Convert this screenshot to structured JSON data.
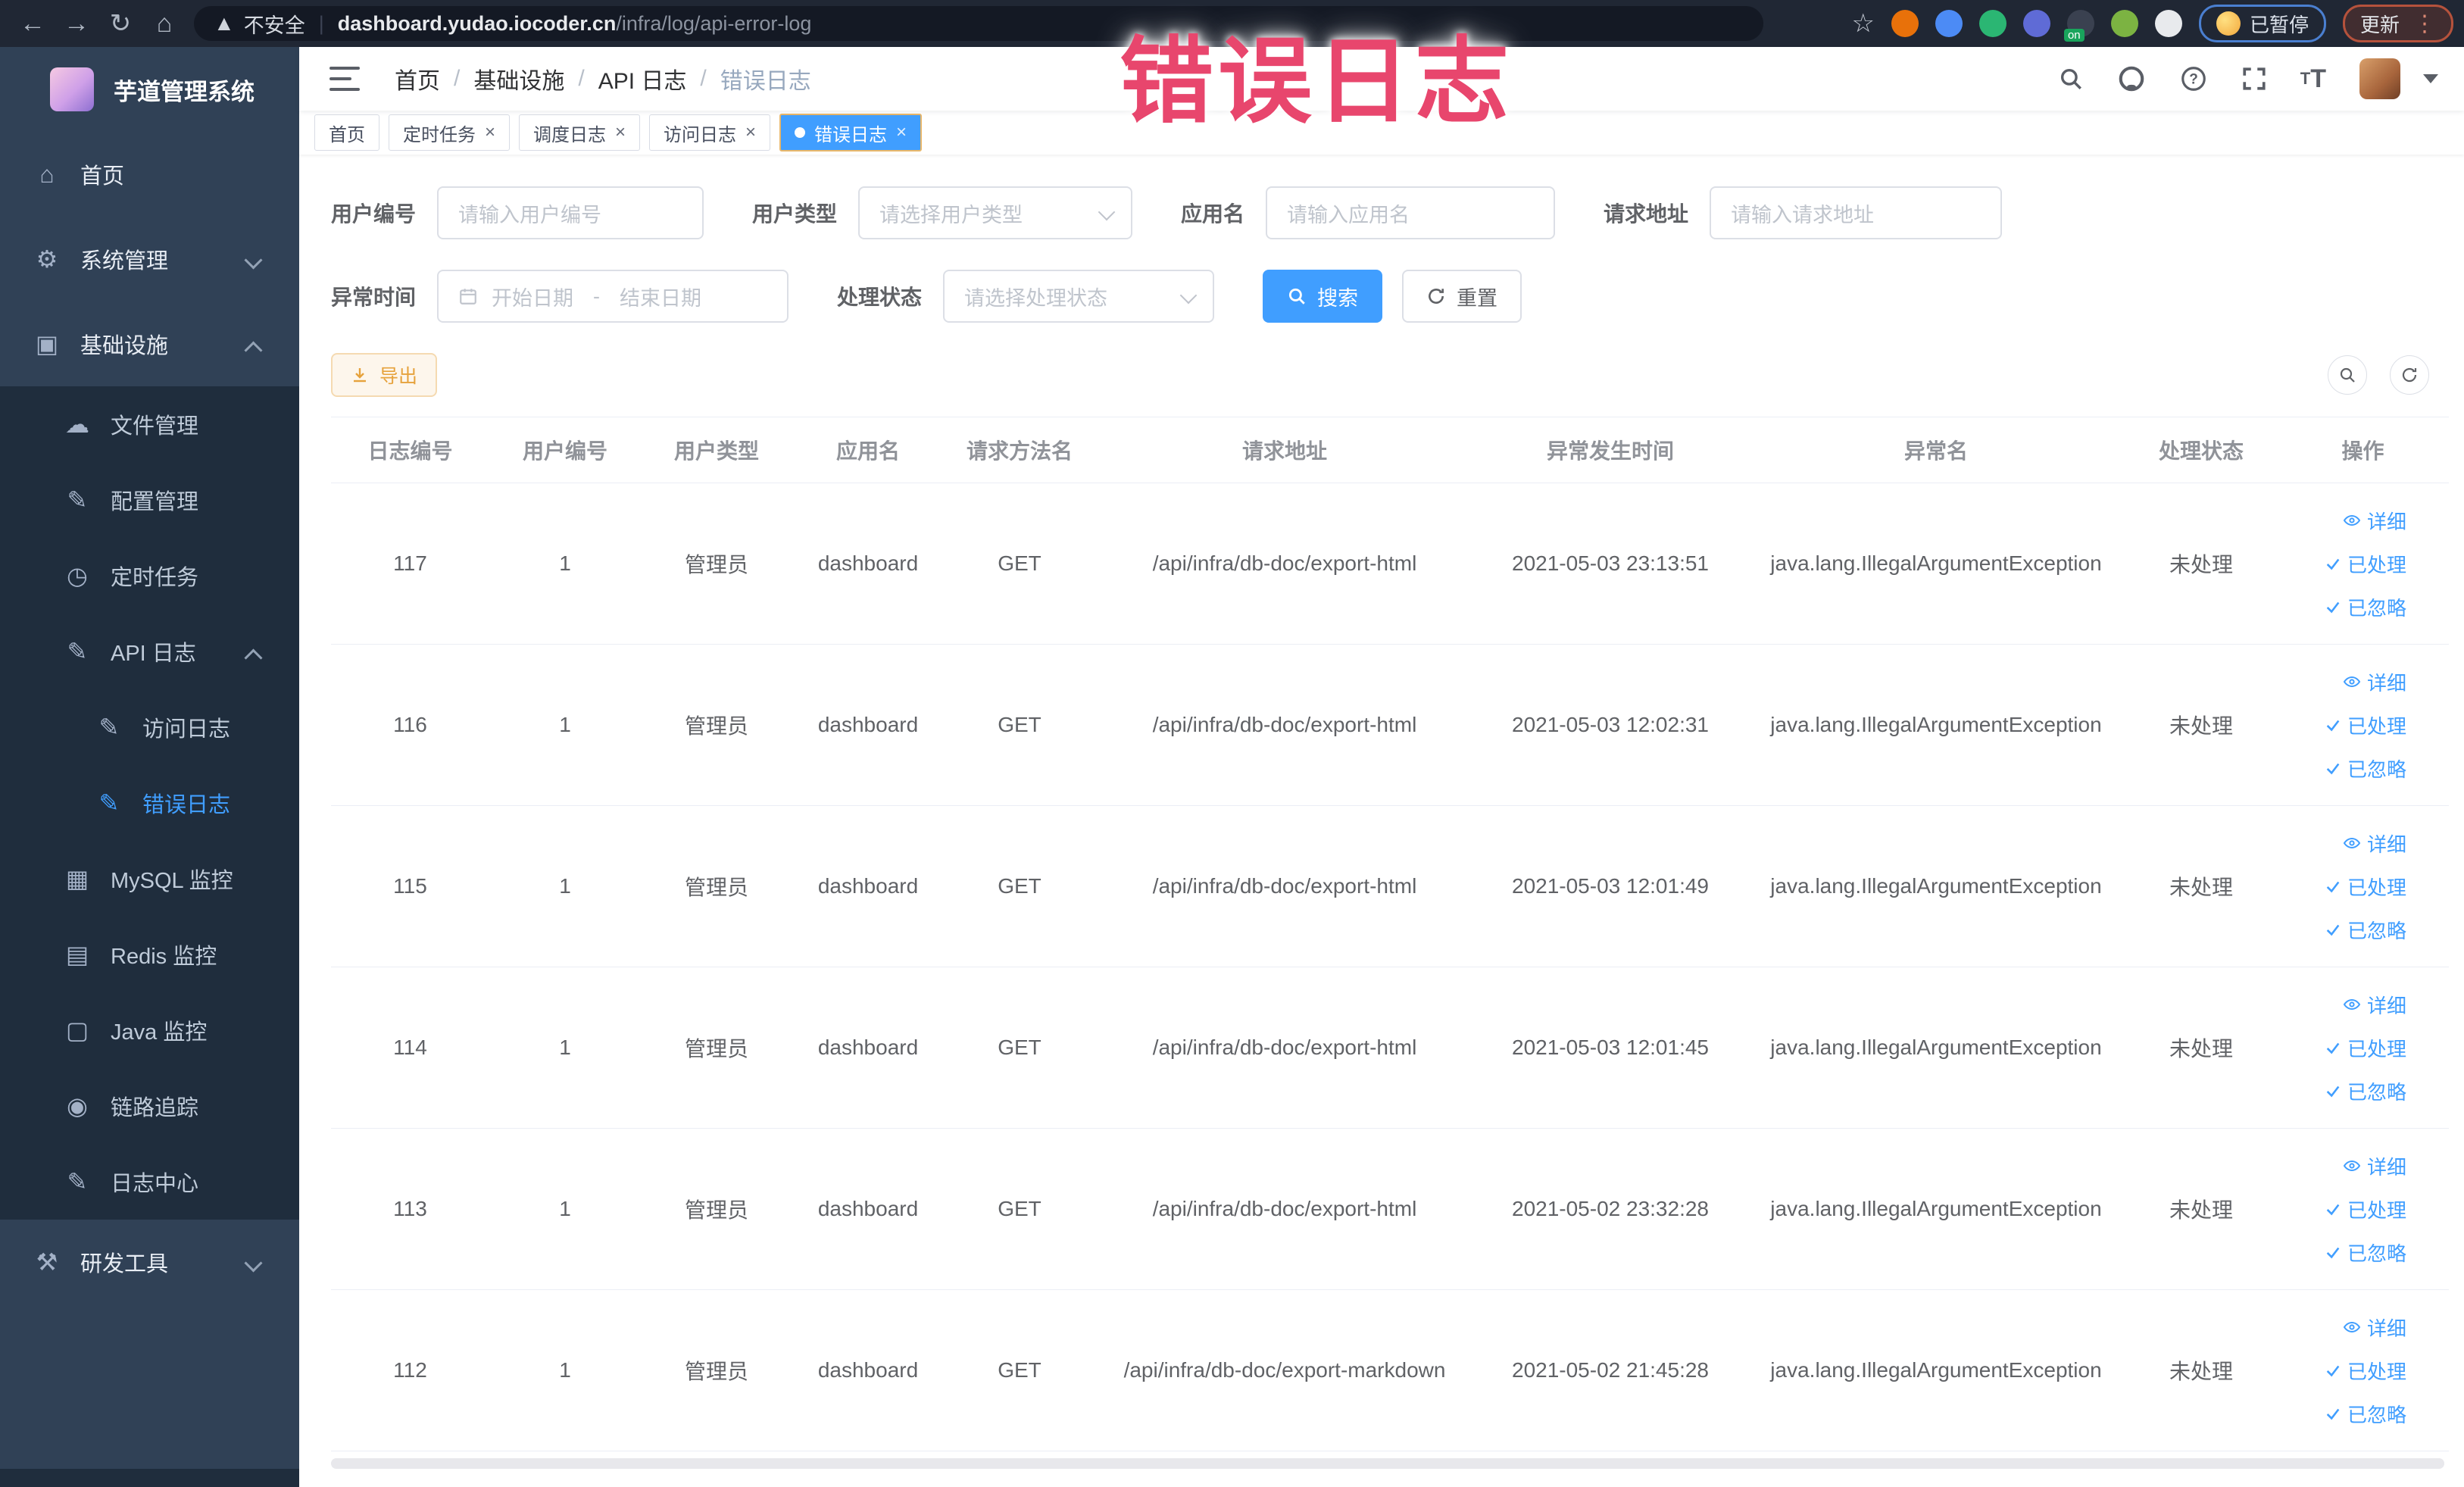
{
  "browser": {
    "security_label": "不安全",
    "url_domain": "dashboard.yudao.iocoder.cn",
    "url_path": "/infra/log/api-error-log",
    "profile_chip_label": "已暂停",
    "update_chip_label": "更新",
    "extensions": [
      {
        "icon": "extension-orange-icon",
        "color": "#e8710a"
      },
      {
        "icon": "extension-location-icon",
        "color": "#4c8bf5"
      },
      {
        "icon": "extension-green-v-icon",
        "color": "#2bb673"
      },
      {
        "icon": "extension-grid-icon",
        "color": "#5f6bd6"
      },
      {
        "icon": "extension-on-icon",
        "color": "#3a4150",
        "badge": "on"
      },
      {
        "icon": "extension-leaf-icon",
        "color": "#7cb342"
      },
      {
        "icon": "extension-puzzle-icon",
        "color": "#e8eaed"
      }
    ]
  },
  "sidebar": {
    "title": "芋道管理系统",
    "items": [
      {
        "key": "home",
        "label": "首页",
        "icon": "dashboard-icon",
        "level": 0
      },
      {
        "key": "system-management",
        "label": "系统管理",
        "icon": "gear-icon",
        "level": 0,
        "chevron": "down"
      },
      {
        "key": "infrastructure",
        "label": "基础设施",
        "icon": "monitor-icon",
        "level": 0,
        "chevron": "up"
      },
      {
        "key": "file-management",
        "label": "文件管理",
        "icon": "cloud-upload-icon",
        "level": 1
      },
      {
        "key": "config-management",
        "label": "配置管理",
        "icon": "edit-icon",
        "level": 1
      },
      {
        "key": "scheduled-jobs",
        "label": "定时任务",
        "icon": "timer-icon",
        "level": 1
      },
      {
        "key": "api-log",
        "label": "API 日志",
        "icon": "log-icon",
        "level": 1,
        "chevron": "up"
      },
      {
        "key": "access-log",
        "label": "访问日志",
        "icon": "log-icon",
        "level": 2
      },
      {
        "key": "error-log",
        "label": "错误日志",
        "icon": "log-icon",
        "level": 2,
        "active": true
      },
      {
        "key": "mysql-monitor",
        "label": "MySQL 监控",
        "icon": "mysql-icon",
        "level": 1
      },
      {
        "key": "redis-monitor",
        "label": "Redis 监控",
        "icon": "redis-icon",
        "level": 1
      },
      {
        "key": "java-monitor",
        "label": "Java 监控",
        "icon": "java-icon",
        "level": 1
      },
      {
        "key": "trace",
        "label": "链路追踪",
        "icon": "eye-icon",
        "level": 1
      },
      {
        "key": "log-center",
        "label": "日志中心",
        "icon": "log-icon",
        "level": 1
      },
      {
        "key": "dev-tools",
        "label": "研发工具",
        "icon": "toolbox-icon",
        "level": 0,
        "chevron": "down"
      }
    ]
  },
  "breadcrumb": {
    "items": [
      "首页",
      "基础设施",
      "API 日志"
    ],
    "current": "错误日志",
    "separator": "/"
  },
  "tags": [
    {
      "label": "首页",
      "closable": false,
      "active": false
    },
    {
      "label": "定时任务",
      "closable": true,
      "active": false
    },
    {
      "label": "调度日志",
      "closable": true,
      "active": false
    },
    {
      "label": "访问日志",
      "closable": true,
      "active": false
    },
    {
      "label": "错误日志",
      "closable": true,
      "active": true
    }
  ],
  "filters": {
    "user_id": {
      "label": "用户编号",
      "placeholder": "请输入用户编号"
    },
    "user_type": {
      "label": "用户类型",
      "placeholder": "请选择用户类型"
    },
    "app_name": {
      "label": "应用名",
      "placeholder": "请输入应用名"
    },
    "request_url": {
      "label": "请求地址",
      "placeholder": "请输入请求地址"
    },
    "exception_time": {
      "label": "异常时间",
      "start_placeholder": "开始日期",
      "separator": "-",
      "end_placeholder": "结束日期"
    },
    "process_status": {
      "label": "处理状态",
      "placeholder": "请选择处理状态"
    },
    "search_button": "搜索",
    "reset_button": "重置"
  },
  "toolbar": {
    "export_button": "导出"
  },
  "table": {
    "columns": [
      "日志编号",
      "用户编号",
      "用户类型",
      "应用名",
      "请求方法名",
      "请求地址",
      "异常发生时间",
      "异常名",
      "处理状态",
      "操作"
    ],
    "row_actions": {
      "detail": "详细",
      "processed": "已处理",
      "ignored": "已忽略"
    },
    "rows": [
      {
        "id": "117",
        "user_id": "1",
        "user_type": "管理员",
        "app": "dashboard",
        "method": "GET",
        "url": "/api/infra/db-doc/export-html",
        "time": "2021-05-03 23:13:51",
        "exception": "java.lang.IllegalArgumentException",
        "status": "未处理"
      },
      {
        "id": "116",
        "user_id": "1",
        "user_type": "管理员",
        "app": "dashboard",
        "method": "GET",
        "url": "/api/infra/db-doc/export-html",
        "time": "2021-05-03 12:02:31",
        "exception": "java.lang.IllegalArgumentException",
        "status": "未处理"
      },
      {
        "id": "115",
        "user_id": "1",
        "user_type": "管理员",
        "app": "dashboard",
        "method": "GET",
        "url": "/api/infra/db-doc/export-html",
        "time": "2021-05-03 12:01:49",
        "exception": "java.lang.IllegalArgumentException",
        "status": "未处理"
      },
      {
        "id": "114",
        "user_id": "1",
        "user_type": "管理员",
        "app": "dashboard",
        "method": "GET",
        "url": "/api/infra/db-doc/export-html",
        "time": "2021-05-03 12:01:45",
        "exception": "java.lang.IllegalArgumentException",
        "status": "未处理"
      },
      {
        "id": "113",
        "user_id": "1",
        "user_type": "管理员",
        "app": "dashboard",
        "method": "GET",
        "url": "/api/infra/db-doc/export-html",
        "time": "2021-05-02 23:32:28",
        "exception": "java.lang.IllegalArgumentException",
        "status": "未处理"
      },
      {
        "id": "112",
        "user_id": "1",
        "user_type": "管理员",
        "app": "dashboard",
        "method": "GET",
        "url": "/api/infra/db-doc/export-markdown",
        "time": "2021-05-02 21:45:28",
        "exception": "java.lang.IllegalArgumentException",
        "status": "未处理"
      }
    ]
  },
  "annotation": {
    "text": "错误日志"
  }
}
